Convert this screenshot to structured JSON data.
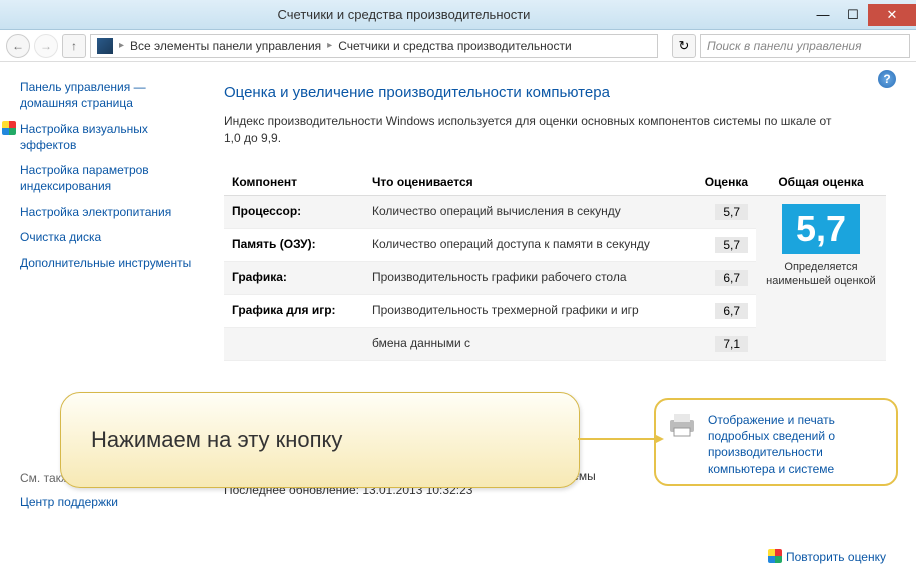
{
  "window": {
    "title": "Счетчики и средства производительности"
  },
  "breadcrumb": {
    "root": "Все элементы панели управления",
    "current": "Счетчики и средства производительности"
  },
  "search": {
    "placeholder": "Поиск в панели управления"
  },
  "sidebar": {
    "home": "Панель управления — домашняя страница",
    "links": [
      "Настройка визуальных эффектов",
      "Настройка параметров индексирования",
      "Настройка электропитания",
      "Очистка диска",
      "Дополнительные инструменты"
    ],
    "see_also": "См. также",
    "support": "Центр поддержки"
  },
  "content": {
    "heading": "Оценка и увеличение производительности компьютера",
    "intro": "Индекс производительности Windows используется для оценки основных компонентов системы по шкале от 1,0 до 9,9.",
    "columns": {
      "component": "Компонент",
      "what": "Что оценивается",
      "score": "Оценка",
      "overall": "Общая оценка"
    },
    "rows": [
      {
        "comp": "Процессор:",
        "desc": "Количество операций вычисления в секунду",
        "score": "5,7"
      },
      {
        "comp": "Память (ОЗУ):",
        "desc": "Количество операций доступа к памяти в секунду",
        "score": "5,7"
      },
      {
        "comp": "Графика:",
        "desc": "Производительность графики рабочего стола",
        "score": "6,7"
      },
      {
        "comp": "Графика для игр:",
        "desc": "Производительность трехмерной графики и игр",
        "score": "6,7"
      },
      {
        "comp": "",
        "desc": "бмена данными с",
        "score": "7,1"
      }
    ],
    "bigscore": "5,7",
    "bigscore_note": "Определяется наименьшей оценкой",
    "footer1": "Оценки соответствуют текущему состоянию компонентов системы",
    "footer2": "Последнее обновление: 13.01.2013 10:32:23",
    "repeat": "Повторить оценку",
    "print_link": "Отображение и печать подробных сведений о производительности компьютера и системе"
  },
  "callout": {
    "text": "Нажимаем на эту кнопку"
  }
}
